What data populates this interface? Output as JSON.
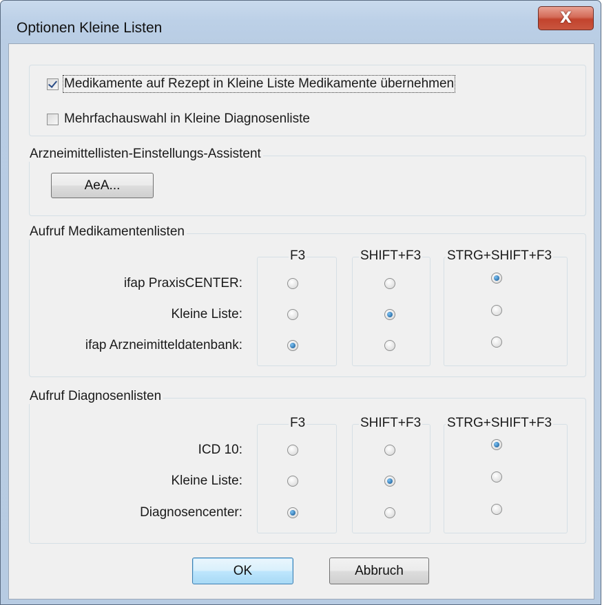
{
  "window": {
    "title": "Optionen Kleine Listen",
    "close_glyph": "X"
  },
  "options": {
    "rezept_checkbox_label": "Medikamente auf Rezept in Kleine Liste Medikamente übernehmen",
    "rezept_checked": true,
    "multi_checkbox_label": "Mehrfachauswahl in Kleine Diagnosenliste",
    "multi_checked": false
  },
  "assistant": {
    "legend": "Arzneimittellisten-Einstellungs-Assistent",
    "button_label": "AeA..."
  },
  "medikamente": {
    "legend": "Aufruf Medikamentenlisten",
    "columns": [
      "F3",
      "SHIFT+F3",
      "STRG+SHIFT+F3"
    ],
    "rows": [
      "ifap PraxisCENTER:",
      "Kleine Liste:",
      "ifap Arzneimitteldatenbank:"
    ],
    "selected_column_per_row": [
      "STRG+SHIFT+F3",
      "SHIFT+F3",
      "F3"
    ]
  },
  "diagnosen": {
    "legend": "Aufruf Diagnosenlisten",
    "columns": [
      "F3",
      "SHIFT+F3",
      "STRG+SHIFT+F3"
    ],
    "rows": [
      "ICD 10:",
      "Kleine Liste:",
      "Diagnosencenter:"
    ],
    "selected_column_per_row": [
      "STRG+SHIFT+F3",
      "SHIFT+F3",
      "F3"
    ]
  },
  "footer": {
    "ok_label": "OK",
    "cancel_label": "Abbruch"
  },
  "colors": {
    "frame": "#b9cde4",
    "client": "#f0f0f0",
    "close_button": "#c9563f",
    "radio_selected": "#0c4f8c"
  }
}
